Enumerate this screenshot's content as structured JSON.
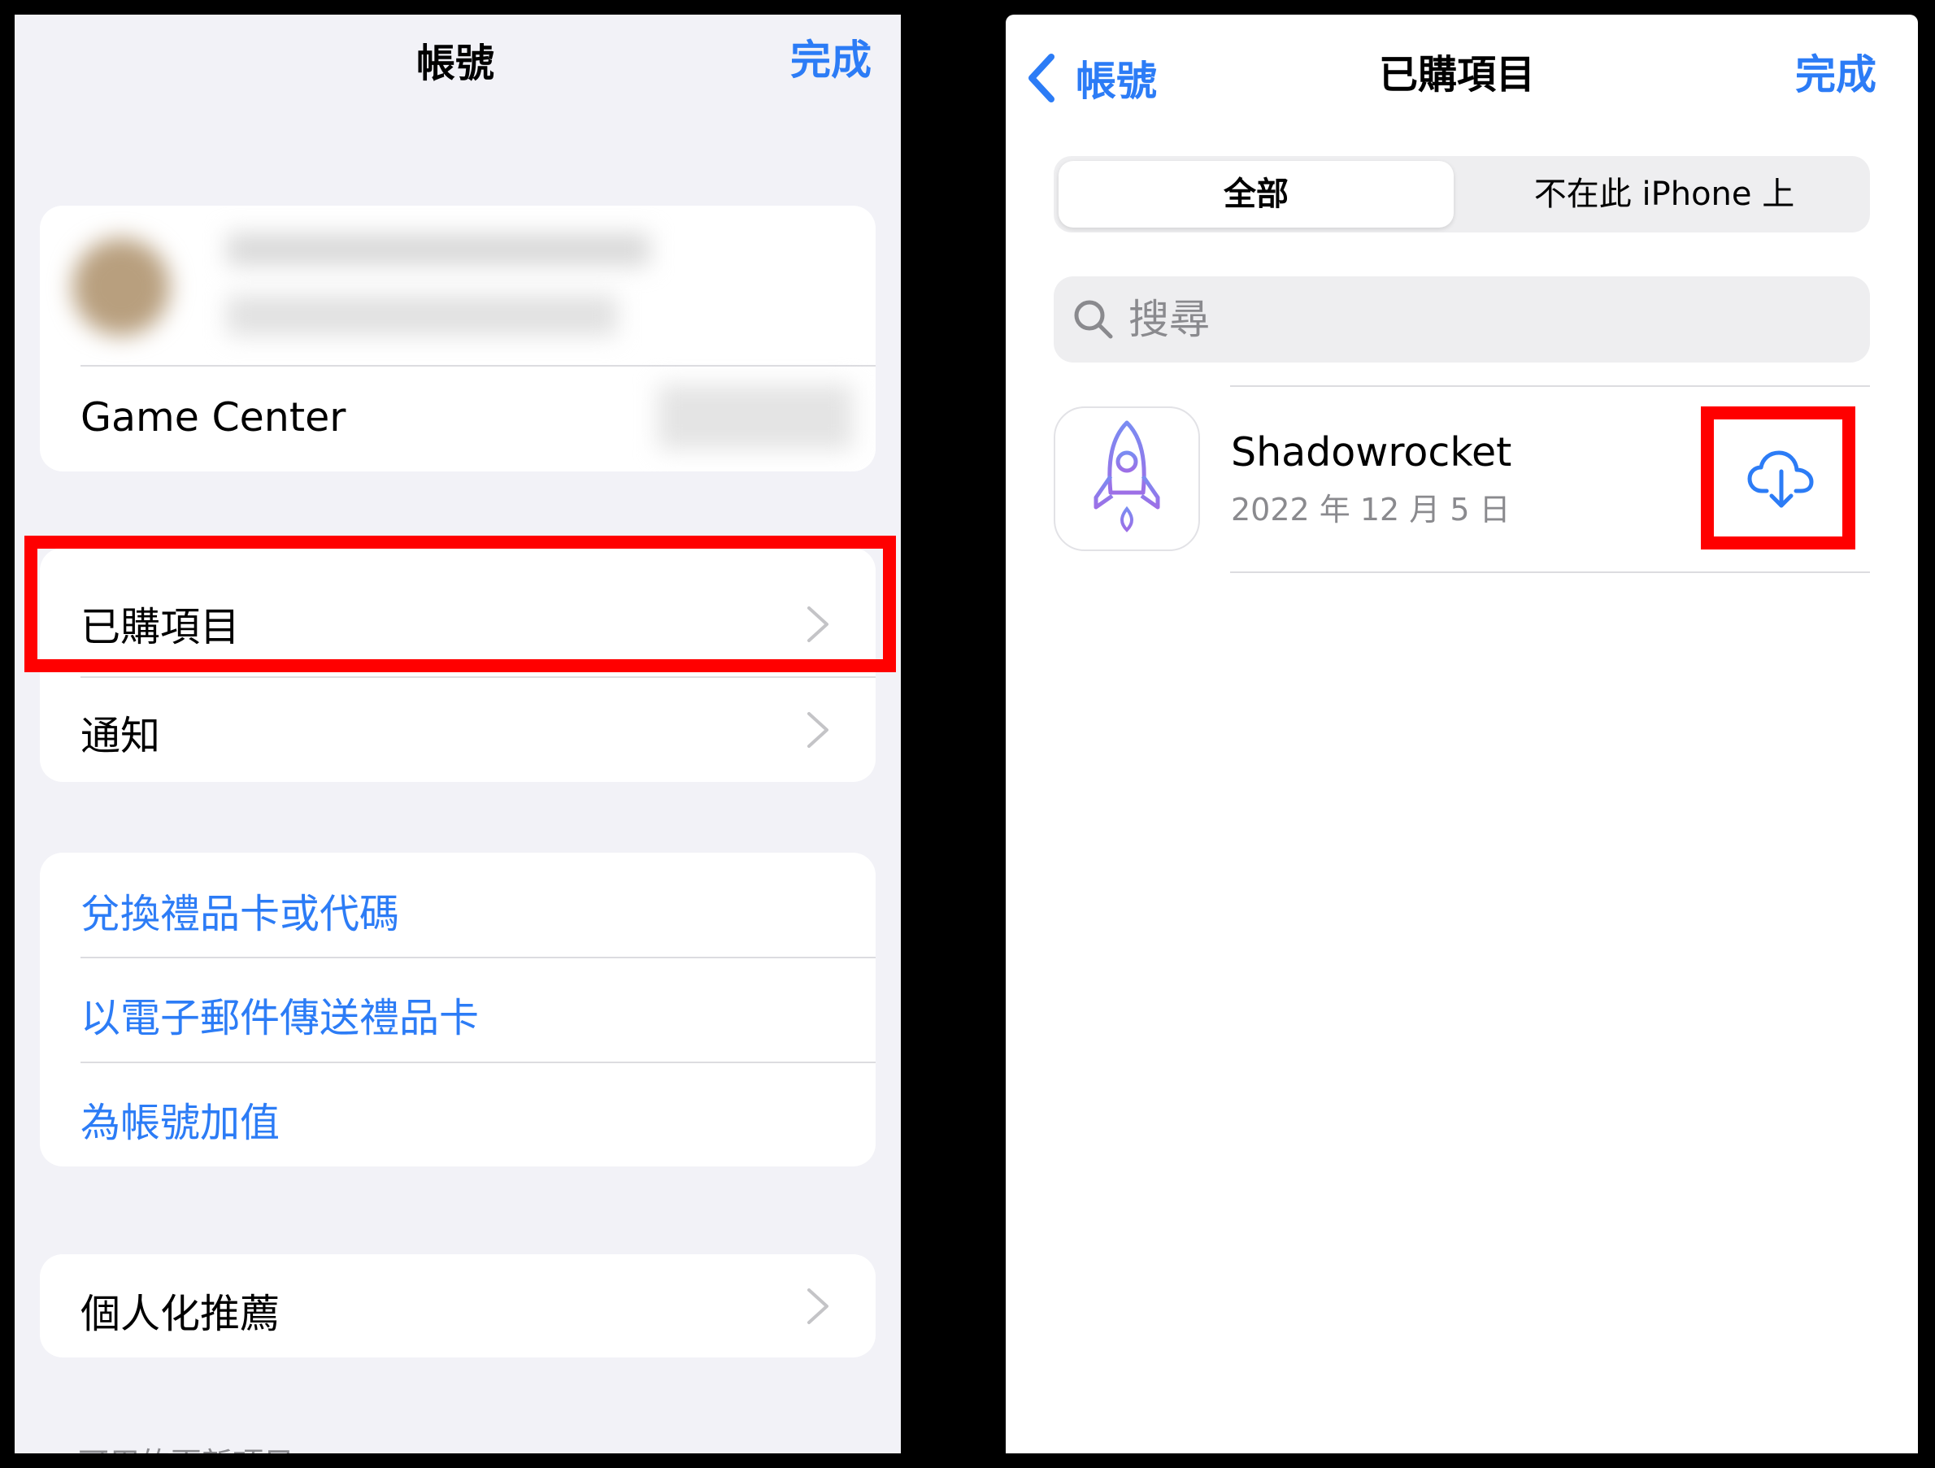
{
  "left_screen": {
    "title": "帳號",
    "done": "完成",
    "game_center_label": "Game Center",
    "purchased_label": "已購項目",
    "notifications_label": "通知",
    "redeem_label": "兌換禮品卡或代碼",
    "send_gift_label": "以電子郵件傳送禮品卡",
    "add_funds_label": "為帳號加值",
    "personalized_label": "個人化推薦",
    "updates_header": "可用的更新項目"
  },
  "right_screen": {
    "back_label": "帳號",
    "title": "已購項目",
    "done": "完成",
    "segments": [
      "全部",
      "不在此 iPhone 上"
    ],
    "selected_segment": "全部",
    "search_placeholder": "搜尋",
    "apps": [
      {
        "name": "Shadowrocket",
        "date": "2022 年 12 月 5 日"
      }
    ]
  },
  "colors": {
    "accent": "#2c7cf6",
    "highlight": "#ff0000",
    "grouped_background": "#f2f2f7"
  }
}
